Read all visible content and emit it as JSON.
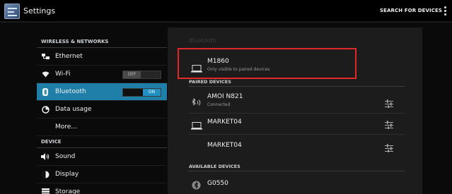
{
  "actionbar": {
    "title": "Settings",
    "search_label": "SEARCH FOR DEVICES",
    "app_icon": "settings-app-icon",
    "overflow_icon": "overflow-menu-icon"
  },
  "sidebar": {
    "sections": [
      {
        "header": "WIRELESS & NETWORKS"
      },
      {
        "header": "DEVICE"
      }
    ],
    "items": [
      {
        "label": "Ethernet",
        "icon": "ethernet-icon"
      },
      {
        "label": "Wi-Fi",
        "icon": "wifi-icon",
        "toggle": "OFF"
      },
      {
        "label": "Bluetooth",
        "icon": "bluetooth-icon",
        "toggle": "ON",
        "selected": true
      },
      {
        "label": "Data usage",
        "icon": "data-usage-icon"
      },
      {
        "label": "More…"
      },
      {
        "label": "Sound",
        "icon": "sound-icon"
      },
      {
        "label": "Display",
        "icon": "display-icon"
      },
      {
        "label": "Storage",
        "icon": "storage-icon"
      }
    ]
  },
  "bluetooth": {
    "title": "Bluetooth",
    "this_device": {
      "name": "M1860",
      "status": "Only visible to paired devices",
      "icon": "laptop-icon"
    },
    "paired_header": "PAIRED DEVICES",
    "paired": [
      {
        "name": "AMOI N821",
        "status": "Connected",
        "icon": "bluetooth-headset-icon"
      },
      {
        "name": "MARKET04",
        "icon": "laptop-icon"
      },
      {
        "name": "MARKET04"
      }
    ],
    "available_header": "AVAILABLE DEVICES",
    "available": [
      {
        "name": "G0550",
        "icon": "bluetooth-circle-icon"
      }
    ]
  },
  "colors": {
    "selected": "#1f7fa8",
    "toggle_on": "#1f8fc4",
    "highlight": "#e0282a"
  }
}
